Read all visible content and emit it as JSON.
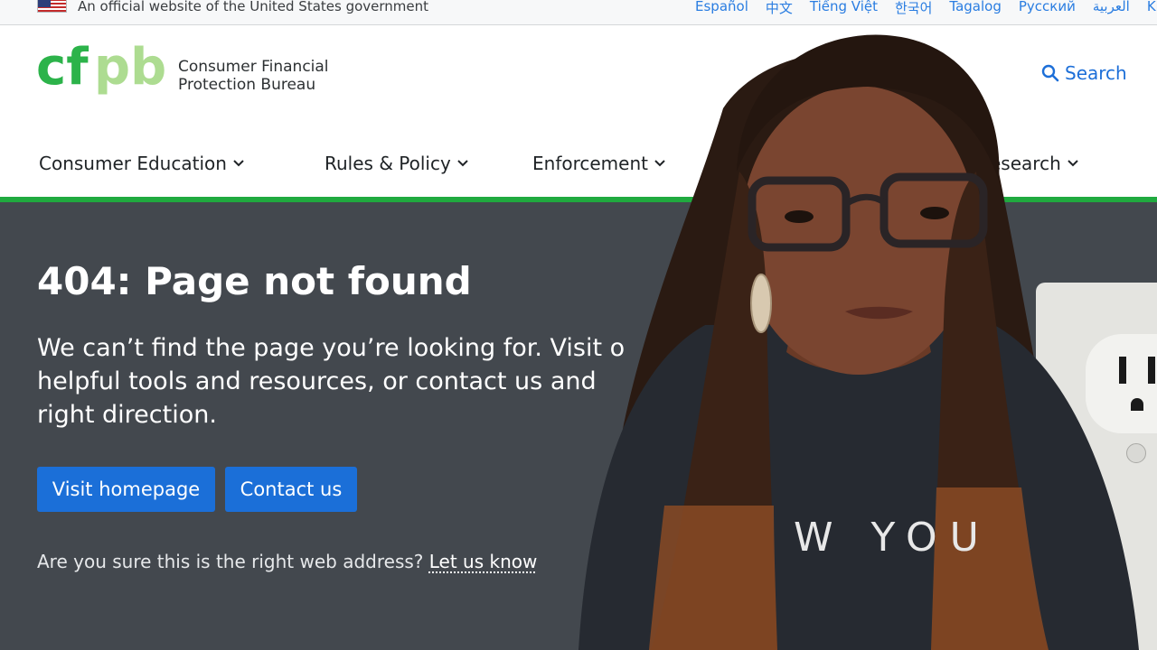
{
  "gov_banner": {
    "text": "An official website of the United States government",
    "languages": [
      "Español",
      "中文",
      "Tiếng Việt",
      "한국어",
      "Tagalog",
      "Русский",
      "العربية",
      "Kr"
    ]
  },
  "header": {
    "logo_text": "cfpb",
    "agency_line1": "Consumer Financial",
    "agency_line2": "Protection Bureau",
    "search_label": "Search",
    "nav": [
      "Consumer Education",
      "Rules & Policy",
      "Enforcement",
      "Research"
    ]
  },
  "error_page": {
    "title": "404: Page not found",
    "lead_line1": "We can’t find the page you’re looking for. Visit o",
    "lead_line2": "helpful tools and resources, or contact us and",
    "lead_line3": "right direction.",
    "primary_button": "Visit homepage",
    "secondary_button": "Contact us",
    "note_text": "Are you sure this is the right web address?",
    "note_link": "Let us know"
  },
  "photo": {
    "shirt_text": "W YOU"
  },
  "colors": {
    "brand_green": "#20aa3f",
    "logo_green_dark": "#2cb34a",
    "logo_green_light": "#addc91",
    "link_blue": "#2a7de1",
    "button_blue": "#1b6fd8",
    "panel_gray": "#43484e"
  }
}
